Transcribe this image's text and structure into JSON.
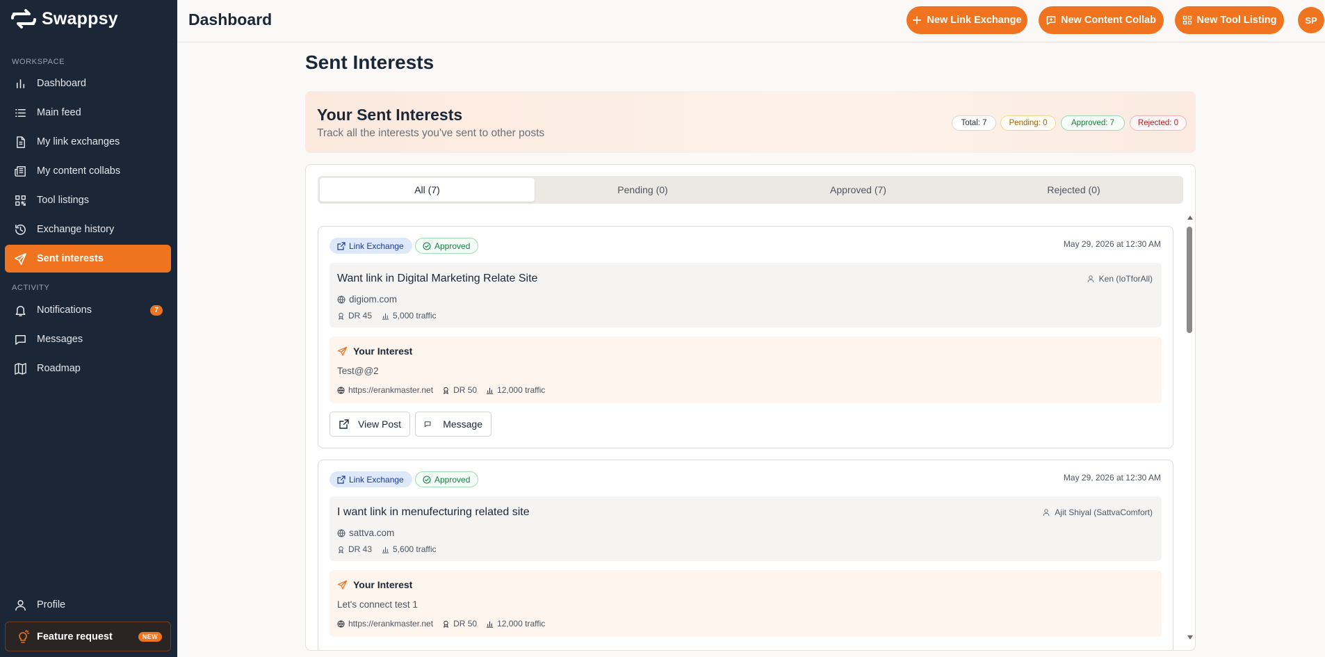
{
  "app": {
    "name": "Swappsy"
  },
  "sidebar": {
    "workspace_label": "WORKSPACE",
    "activity_label": "ACTIVITY",
    "workspace_items": [
      {
        "label": "Dashboard",
        "icon": "bar-chart-icon"
      },
      {
        "label": "Main feed",
        "icon": "list-icon"
      },
      {
        "label": "My link exchanges",
        "icon": "document-icon"
      },
      {
        "label": "My content collabs",
        "icon": "newspaper-icon"
      },
      {
        "label": "Tool listings",
        "icon": "qr-grid-icon"
      },
      {
        "label": "Exchange history",
        "icon": "history-icon"
      },
      {
        "label": "Sent interests",
        "icon": "send-icon"
      }
    ],
    "activity_items": [
      {
        "label": "Notifications",
        "icon": "bell-icon",
        "badge": "7"
      },
      {
        "label": "Messages",
        "icon": "message-icon"
      },
      {
        "label": "Roadmap",
        "icon": "map-icon"
      }
    ],
    "profile_label": "Profile",
    "feature_request_label": "Feature request",
    "feature_request_badge": "NEW"
  },
  "header": {
    "title": "Dashboard",
    "buttons": {
      "new_link_exchange": "New Link Exchange",
      "new_content_collab": "New Content Collab",
      "new_tool_listing": "New Tool Listing"
    },
    "avatar_initials": "SP"
  },
  "main": {
    "page_title": "Sent Interests",
    "summary": {
      "title": "Your Sent Interests",
      "subtitle": "Track all the interests you've sent to other posts",
      "stats": {
        "total": "Total: 7",
        "pending": "Pending: 0",
        "approved": "Approved: 7",
        "rejected": "Rejected: 0"
      }
    },
    "tabs": {
      "all": "All (7)",
      "pending": "Pending (0)",
      "approved": "Approved (7)",
      "rejected": "Rejected (0)"
    },
    "cards": [
      {
        "type": "Link Exchange",
        "status": "Approved",
        "date": "May 29, 2026 at 12:30 AM",
        "post_title": "Want link in Digital Marketing Relate Site",
        "author": "Ken (IoTforAll)",
        "site": "digiom.com",
        "dr": "DR 45",
        "traffic": "5,000 traffic",
        "interest_label": "Your Interest",
        "interest_message": "Test@@2",
        "interest_url": "https://erankmaster.net",
        "interest_dr": "DR 50",
        "interest_traffic": "12,000 traffic",
        "view_post": "View Post",
        "message": "Message"
      },
      {
        "type": "Link Exchange",
        "status": "Approved",
        "date": "May 29, 2026 at 12:30 AM",
        "post_title": "I want link in menufecturing related site",
        "author": "Ajit Shiyal (SattvaComfort)",
        "site": "sattva.com",
        "dr": "DR 43",
        "traffic": "5,600 traffic",
        "interest_label": "Your Interest",
        "interest_message": "Let's connect test 1",
        "interest_url": "https://erankmaster.net",
        "interest_dr": "DR 50",
        "interest_traffic": "12,000 traffic"
      }
    ]
  },
  "colors": {
    "sidebar_bg": "#1b2637",
    "accent": "#f0741f",
    "page_bg": "#faf9f7",
    "approved": "#15803d",
    "pending": "#a16207",
    "rejected": "#b91c1c"
  }
}
